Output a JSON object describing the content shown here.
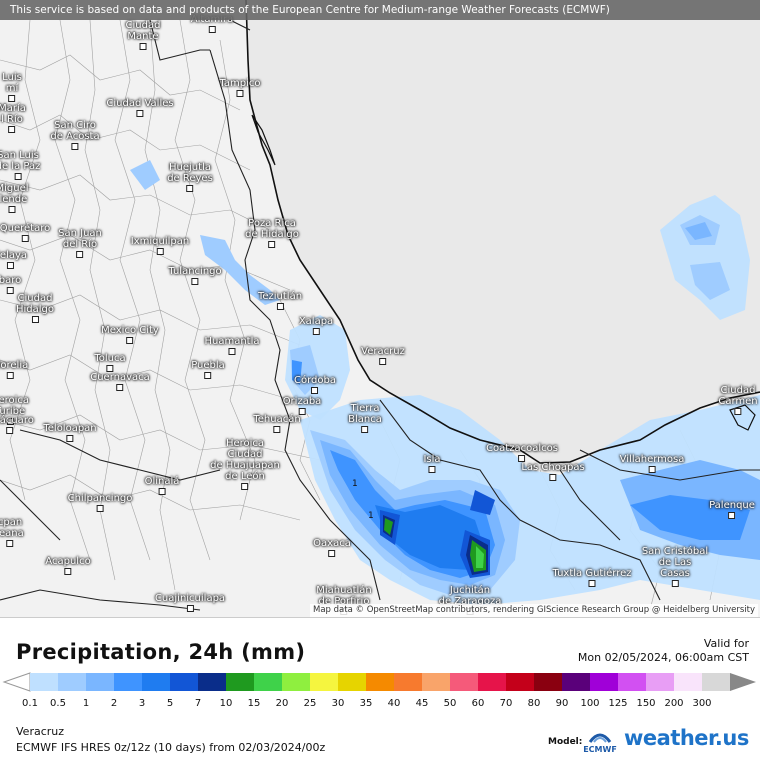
{
  "banner": "This service is based on data and products of the European Centre for Medium-range Weather Forecasts (ECMWF)",
  "attribution": "Map data © OpenStreetMap contributors, rendering GIScience Research Group @ Heidelberg University",
  "cities": [
    {
      "id": "ciudad-mante",
      "label": "Ciudad\nMante"
    },
    {
      "id": "altamira",
      "label": "Altamira"
    },
    {
      "id": "tampico",
      "label": "Tampico"
    },
    {
      "id": "ciudad-valles",
      "label": "Ciudad Valles"
    },
    {
      "id": "san-ciro",
      "label": "San Ciro\nde Acosta"
    },
    {
      "id": "huejutla",
      "label": "Huejutla\nde Reyes"
    },
    {
      "id": "poza-rica",
      "label": "Poza Rica\nde Hidalgo"
    },
    {
      "id": "san-juan-rio",
      "label": "San Juan\ndel Río"
    },
    {
      "id": "ixmiquilpan",
      "label": "Ixmiquilpan"
    },
    {
      "id": "queretaro",
      "label": "Querétaro"
    },
    {
      "id": "tulancingo",
      "label": "Tulancingo"
    },
    {
      "id": "teziutlan",
      "label": "Teziutlán"
    },
    {
      "id": "ciudad-hidalgo",
      "label": "Ciudad\nHidalgo"
    },
    {
      "id": "xalapa",
      "label": "Xalapa"
    },
    {
      "id": "mexico-city",
      "label": "Mexico City"
    },
    {
      "id": "huamantla",
      "label": "Huamantla"
    },
    {
      "id": "veracruz",
      "label": "Veracruz"
    },
    {
      "id": "toluca",
      "label": "Toluca"
    },
    {
      "id": "puebla",
      "label": "Puebla"
    },
    {
      "id": "cuernavaca",
      "label": "Cuernavaca"
    },
    {
      "id": "cordoba",
      "label": "Córdoba"
    },
    {
      "id": "orizaba",
      "label": "Orizaba"
    },
    {
      "id": "tierra-blanca",
      "label": "Tierra\nBlanca"
    },
    {
      "id": "tehuacan",
      "label": "Tehuacán"
    },
    {
      "id": "teloloapan",
      "label": "Teloloapan"
    },
    {
      "id": "huajuapan",
      "label": "Heroica\nCiudad\nde Huajuapan\nde León"
    },
    {
      "id": "olinala",
      "label": "Olinalá"
    },
    {
      "id": "coatzacoalcos",
      "label": "Coatzacoalcos"
    },
    {
      "id": "isla",
      "label": "Isla"
    },
    {
      "id": "las-choapas",
      "label": "Las Choapas"
    },
    {
      "id": "villahermosa",
      "label": "Villahermosa"
    },
    {
      "id": "ciudad-carmen",
      "label": "Ciudad\nCarmen"
    },
    {
      "id": "chilpancingo",
      "label": "Chilpancingo"
    },
    {
      "id": "palenque",
      "label": "Palenque"
    },
    {
      "id": "oaxaca",
      "label": "Oaxaca"
    },
    {
      "id": "acapulco",
      "label": "Acapulco"
    },
    {
      "id": "san-cristobal",
      "label": "San Cristóbal\nde Las\nCasas"
    },
    {
      "id": "tuxtla",
      "label": "Tuxtla Gutiérrez"
    },
    {
      "id": "miahuatlan",
      "label": "Miahuatlán\nde Porfirio"
    },
    {
      "id": "juchitan",
      "label": "Juchitán\nde Zaragoza"
    },
    {
      "id": "cuajinicuilapa",
      "label": "Cuajinicuilapa"
    },
    {
      "id": "luis",
      "label": "Luis\nmí"
    },
    {
      "id": "maria",
      "label": "María\nl Río"
    },
    {
      "id": "san-luis-paz",
      "label": "San Luis\nde la Paz"
    },
    {
      "id": "miguel-allende",
      "label": "Miguel\nllende"
    },
    {
      "id": "celaya",
      "label": "Celaya"
    },
    {
      "id": "carlo",
      "label": "baro"
    },
    {
      "id": "morelia",
      "label": "Morelia"
    },
    {
      "id": "iturbide",
      "label": "Heroica\nTuribe"
    },
    {
      "id": "zitacuaro",
      "label": "Zitácuaro"
    },
    {
      "id": "tecpan",
      "label": "cpan\nleana"
    }
  ],
  "legend": {
    "title": "Precipitation, 24h (mm)",
    "valid_label": "Valid for",
    "valid_date": "Mon 02/05/2024, 06:00am CST",
    "scale": [
      {
        "value": "0.1",
        "color": "#bfe0ff"
      },
      {
        "value": "0.5",
        "color": "#9fccff"
      },
      {
        "value": "1",
        "color": "#7ab6ff"
      },
      {
        "value": "2",
        "color": "#3f94ff"
      },
      {
        "value": "3",
        "color": "#1f7cf0"
      },
      {
        "value": "5",
        "color": "#1256d6"
      },
      {
        "value": "7",
        "color": "#0a2d8a"
      },
      {
        "value": "10",
        "color": "#1f9a1f"
      },
      {
        "value": "15",
        "color": "#3fd24a"
      },
      {
        "value": "20",
        "color": "#8fef3f"
      },
      {
        "value": "25",
        "color": "#f5f53f"
      },
      {
        "value": "30",
        "color": "#e6d400"
      },
      {
        "value": "35",
        "color": "#f58a00"
      },
      {
        "value": "40",
        "color": "#f77a2e"
      },
      {
        "value": "45",
        "color": "#f9a46a"
      },
      {
        "value": "50",
        "color": "#f55a7a"
      },
      {
        "value": "60",
        "color": "#e6144a"
      },
      {
        "value": "70",
        "color": "#c4001a"
      },
      {
        "value": "80",
        "color": "#8a0010"
      },
      {
        "value": "90",
        "color": "#5a007a"
      },
      {
        "value": "100",
        "color": "#a000d8"
      },
      {
        "value": "125",
        "color": "#d250f2"
      },
      {
        "value": "150",
        "color": "#e89ef5"
      },
      {
        "value": "200",
        "color": "#f9e4fb"
      },
      {
        "value": "300",
        "color": "#d8d8d8"
      }
    ]
  },
  "footer": {
    "region": "Veracruz",
    "model_run": "ECMWF IFS HRES 0z/12z (10 days) from  02/03/2024/00z",
    "model_label": "Model:",
    "ecmwf": "ECMWF",
    "brand": "weather.us",
    "brand_accent": "us"
  }
}
